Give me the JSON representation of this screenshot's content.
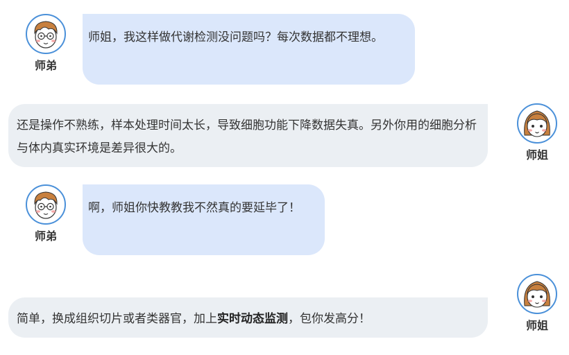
{
  "characters": {
    "junior": {
      "name": "师弟",
      "avatar_icon": "boy-with-glasses-icon"
    },
    "senior": {
      "name": "师姐",
      "avatar_icon": "girl-with-bangs-icon"
    }
  },
  "messages": [
    {
      "speaker": "师弟",
      "side": "left",
      "text": "师姐，我这样做代谢检测没问题吗？每次数据都不理想。"
    },
    {
      "speaker": "师姐",
      "side": "right",
      "text": "还是操作不熟练，样本处理时间太长，导致细胞功能下降数据失真。另外你用的细胞分析与体内真实环境是差异很大的。"
    },
    {
      "speaker": "师弟",
      "side": "left",
      "text": "啊，师姐你快教教我不然真的要延毕了！"
    },
    {
      "speaker": "师姐",
      "side": "right",
      "text_before": "简单，换成组织切片或者类器官，加上",
      "text_bold": "实时动态监测",
      "text_after": "，包你发高分！"
    }
  ],
  "colors": {
    "left_bubble": "#dbe7fb",
    "right_bubble": "#ebeff3",
    "avatar_border": "#4a90d9",
    "hair": "#c8803e",
    "blush": "#f4a7a7"
  }
}
